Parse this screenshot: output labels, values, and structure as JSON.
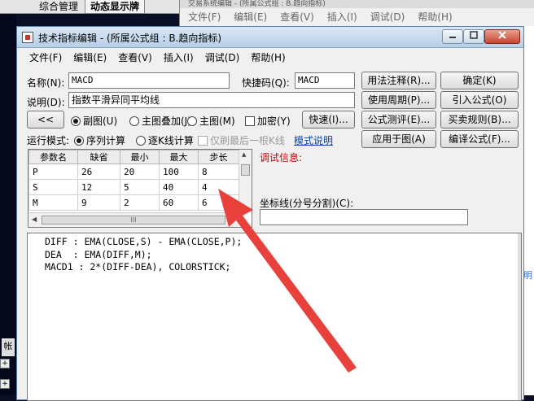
{
  "background_app": {
    "tabs": [
      "综合管理",
      "动态显示牌"
    ],
    "second_window_title": "交易系统编辑 - (所属公式组 : B.趋向指标)",
    "second_window_menu": [
      "文件(F)",
      "编辑(E)",
      "查看(V)",
      "插入(I)",
      "调试(D)",
      "帮助(H)"
    ],
    "side_label": "帐",
    "right_link": "明"
  },
  "dialog": {
    "title": "技术指标编辑 - (所属公式组 : B.趋向指标)",
    "controls": {
      "min": "0",
      "max": "1",
      "close": "x"
    },
    "menu": [
      "文件(F)",
      "编辑(E)",
      "查看(V)",
      "插入(I)",
      "调试(D)",
      "帮助(H)"
    ],
    "name_label": "名称(N):",
    "name_value": "MACD",
    "shortcut_label": "快捷码(Q):",
    "shortcut_value": "MACD",
    "desc_label": "说明(D):",
    "desc_value": "指数平滑异同平均线",
    "buttons": {
      "usage_note": "用法注释(R)...",
      "confirm": "确定(K)",
      "usage_period": "使用周期(P)...",
      "import_formula": "引入公式(O)",
      "formula_test": "公式测评(E)...",
      "trade_rules": "买卖规则(B)...",
      "apply_chart": "应用于图(A)",
      "translate_formula": "编译公式(F)...",
      "quick_speed": "快速(I)..."
    },
    "collapse_button": "<<",
    "chart_modes": {
      "sub_chart": "副图(U)",
      "main_overlay": "主图叠加(J)",
      "main_chart": "主图(M)"
    },
    "encrypt_label": "加密(Y)",
    "run_mode_label": "运行模式:",
    "run_modes": {
      "sequential": "序列计算",
      "bar_by_bar": "逐K线计算"
    },
    "last_bar_only": "仅刷最后一根K线",
    "mode_help": "模式说明",
    "debug_info_label": "调试信息:",
    "coord_label": "坐标线(分号分割)(C):"
  },
  "param_table": {
    "headers": [
      "参数名",
      "缺省",
      "最小",
      "最大",
      "步长"
    ],
    "rows": [
      [
        "P",
        "26",
        "20",
        "100",
        "8"
      ],
      [
        "S",
        "12",
        "5",
        "40",
        "4"
      ],
      [
        "M",
        "9",
        "2",
        "60",
        "6"
      ]
    ],
    "scroll_grip": "III"
  },
  "code": {
    "lines": [
      "DIFF : EMA(CLOSE,S) - EMA(CLOSE,P);",
      "DEA  : EMA(DIFF,M);",
      "MACD1 : 2*(DIFF-DEA), COLORSTICK;"
    ]
  },
  "colors": {
    "accent_arrow": "#e8413b",
    "link": "#0645ad",
    "debug_label": "#cc0000"
  }
}
